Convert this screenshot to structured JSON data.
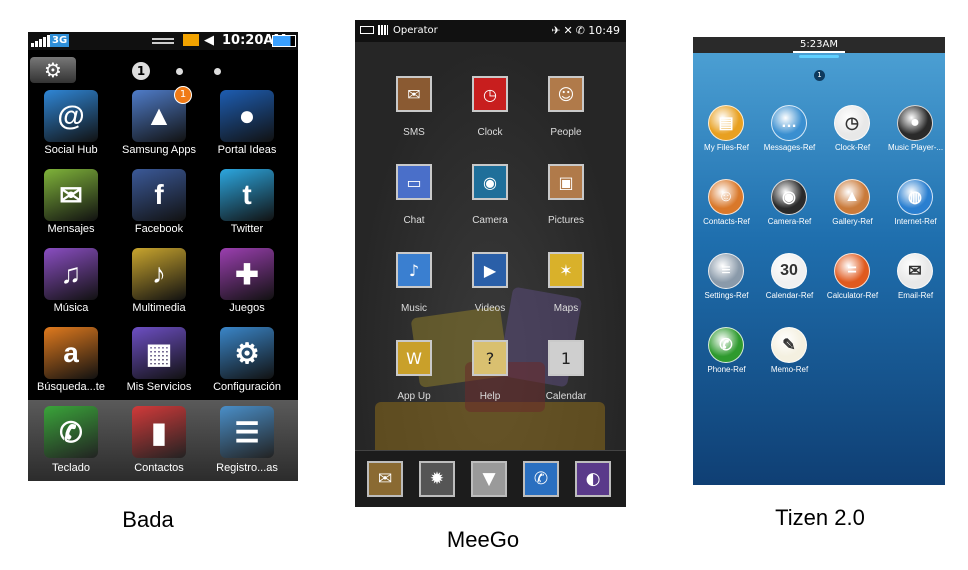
{
  "captions": {
    "bada": "Bada",
    "meego": "MeeGo",
    "tizen": "Tizen 2.0"
  },
  "bada": {
    "status": {
      "network": "3G",
      "time": "10:20AM"
    },
    "page_indicator": "1",
    "apps": [
      {
        "label": "Social Hub",
        "icon": "social-hub-icon",
        "glyph": "@",
        "color": "#2f86d6"
      },
      {
        "label": "Samsung Apps",
        "icon": "samsung-apps-icon",
        "glyph": "▲",
        "color": "#4f7cc9",
        "badge": "1"
      },
      {
        "label": "Portal Ideas",
        "icon": "portal-ideas-icon",
        "glyph": "●",
        "color": "#1d5db2"
      },
      {
        "label": "Mensajes",
        "icon": "messages-icon",
        "glyph": "✉",
        "color": "#7fb33a"
      },
      {
        "label": "Facebook",
        "icon": "facebook-icon",
        "glyph": "f",
        "color": "#3b5998"
      },
      {
        "label": "Twitter",
        "icon": "twitter-icon",
        "glyph": "t",
        "color": "#2ca7e0"
      },
      {
        "label": "Música",
        "icon": "music-icon",
        "glyph": "♫",
        "color": "#8a4ec2"
      },
      {
        "label": "Multimedia",
        "icon": "multimedia-icon",
        "glyph": "♪",
        "color": "#c9a52e"
      },
      {
        "label": "Juegos",
        "icon": "games-icon",
        "glyph": "✚",
        "color": "#9b3fb0"
      },
      {
        "label": "Búsqueda...te",
        "icon": "search-icon",
        "glyph": "a",
        "color": "#e07a1e"
      },
      {
        "label": "Mis Servicios",
        "icon": "sim-services-icon",
        "glyph": "▦",
        "color": "#6d4fc4"
      },
      {
        "label": "Configuración",
        "icon": "settings-icon",
        "glyph": "⚙",
        "color": "#3a86c9"
      }
    ],
    "dock": [
      {
        "label": "Teclado",
        "icon": "phone-icon",
        "glyph": "✆",
        "color": "#3aa53a"
      },
      {
        "label": "Contactos",
        "icon": "contacts-book-icon",
        "glyph": "▮",
        "color": "#d23a3a"
      },
      {
        "label": "Registro...as",
        "icon": "call-log-icon",
        "glyph": "☰",
        "color": "#4a8fc9"
      }
    ]
  },
  "meego": {
    "status": {
      "operator": "Operator",
      "time": "10:49"
    },
    "apps": [
      {
        "label": "SMS",
        "icon": "sms-icon",
        "glyph": "✉",
        "color": "#8a5a32"
      },
      {
        "label": "Clock",
        "icon": "clock-icon",
        "glyph": "◷",
        "color": "#c81e1e"
      },
      {
        "label": "People",
        "icon": "people-icon",
        "glyph": "☺",
        "color": "#b07a4a"
      },
      {
        "label": "Chat",
        "icon": "chat-icon",
        "glyph": "▭",
        "color": "#4a6fc9"
      },
      {
        "label": "Camera",
        "icon": "camera-icon",
        "glyph": "◉",
        "color": "#1f6f9a"
      },
      {
        "label": "Pictures",
        "icon": "pictures-icon",
        "glyph": "▣",
        "color": "#b07a4a"
      },
      {
        "label": "Music",
        "icon": "music-icon",
        "glyph": "♪",
        "color": "#3a7fd0"
      },
      {
        "label": "Videos",
        "icon": "videos-icon",
        "glyph": "▶",
        "color": "#2a5fa8"
      },
      {
        "label": "Maps",
        "icon": "maps-icon",
        "glyph": "✶",
        "color": "#d9b12a"
      },
      {
        "label": "App Up",
        "icon": "app-up-icon",
        "glyph": "W",
        "color": "#c9a02a"
      },
      {
        "label": "Help",
        "icon": "help-icon",
        "glyph": "?",
        "color": "#d9c070"
      },
      {
        "label": "Calendar",
        "icon": "calendar-icon",
        "glyph": "1",
        "color": "#cfcfcf"
      }
    ],
    "dock": [
      {
        "icon": "mail-icon",
        "glyph": "✉",
        "color": "#8a6a32"
      },
      {
        "icon": "web-browser-icon",
        "glyph": "✹",
        "color": "#555555"
      },
      {
        "icon": "downloads-icon",
        "glyph": "▼",
        "color": "#9a9a9a"
      },
      {
        "icon": "phone-icon",
        "glyph": "✆",
        "color": "#2a6fc0"
      },
      {
        "icon": "world-clock-icon",
        "glyph": "◐",
        "color": "#5a3a8a"
      }
    ]
  },
  "tizen": {
    "status": {
      "time": "5:23AM"
    },
    "page_indicator": "1",
    "apps": [
      {
        "label": "My Files-Ref",
        "icon": "my-files-icon",
        "glyph": "▤",
        "color": "#e8a020"
      },
      {
        "label": "Messages-Ref",
        "icon": "messages-icon",
        "glyph": "…",
        "color": "#3a8fd0"
      },
      {
        "label": "Clock-Ref",
        "icon": "clock-icon",
        "glyph": "◷",
        "color": "#e8e8e8"
      },
      {
        "label": "Music Player-...",
        "icon": "music-player-icon",
        "glyph": "●",
        "color": "#2a2a2a"
      },
      {
        "label": "Contacts-Ref",
        "icon": "contacts-icon",
        "glyph": "☺",
        "color": "#d9782a"
      },
      {
        "label": "Camera-Ref",
        "icon": "camera-icon",
        "glyph": "◉",
        "color": "#2a2a2a"
      },
      {
        "label": "Gallery-Ref",
        "icon": "gallery-icon",
        "glyph": "▲",
        "color": "#c97a3a"
      },
      {
        "label": "Internet-Ref",
        "icon": "internet-icon",
        "glyph": "◍",
        "color": "#2a7fd0"
      },
      {
        "label": "Settings-Ref",
        "icon": "settings-icon",
        "glyph": "≡",
        "color": "#8a9aaa"
      },
      {
        "label": "Calendar-Ref",
        "icon": "calendar-icon",
        "glyph": "30",
        "color": "#f0f0f0"
      },
      {
        "label": "Calculator-Ref",
        "icon": "calculator-icon",
        "glyph": "=",
        "color": "#e05a1e"
      },
      {
        "label": "Email-Ref",
        "icon": "email-icon",
        "glyph": "✉",
        "color": "#e8e8e8"
      },
      {
        "label": "Phone-Ref",
        "icon": "phone-icon",
        "glyph": "✆",
        "color": "#2e9a2e"
      },
      {
        "label": "Memo-Ref",
        "icon": "memo-icon",
        "glyph": "✎",
        "color": "#f4f0e0"
      }
    ]
  }
}
